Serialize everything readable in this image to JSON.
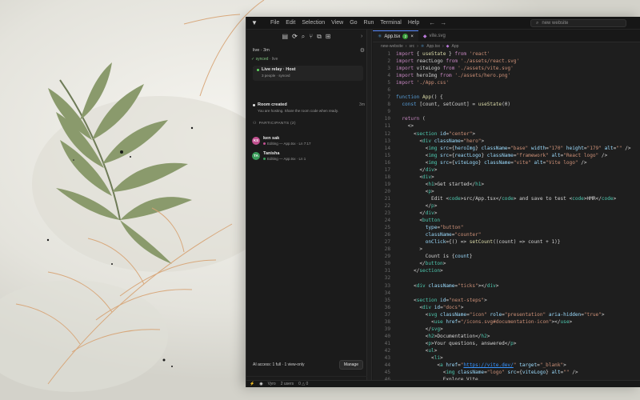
{
  "colors": {
    "accent": "#5b8cff",
    "synced_green": "#5fd35f",
    "avatar_ks": "#c0508f",
    "avatar_ta": "#3a9c5a",
    "leaf_green": "#8a9a6c",
    "orange_line": "#d7a272"
  },
  "titlebar": {
    "menu": [
      "File",
      "Edit",
      "Selection",
      "View",
      "Go",
      "Run",
      "Terminal",
      "Help"
    ],
    "search_placeholder": "new website"
  },
  "sidebar": {
    "toolbar_icons": [
      "files-icon",
      "collab-icon",
      "search-icon",
      "branch-icon",
      "extensions-icon",
      "layout-icon"
    ],
    "session": {
      "mode": "live · 3m",
      "code": "VYR-6UEM-E89Z"
    },
    "synced": {
      "label": "✓ synced",
      "rest": " · live"
    },
    "relay": {
      "title": "Live relay · Host",
      "subtitle": "3 people · synced"
    },
    "room": {
      "title": "Room created",
      "time": "3m",
      "subtitle": "You are hosting. Share the room code when ready."
    },
    "participants_header": "PARTICIPANTS (2)",
    "participants": [
      {
        "initials": "KS",
        "name": "ken sak",
        "status": "Editing — App.tsx · Ln 7:17"
      },
      {
        "initials": "TA",
        "name": "Tanisha",
        "status": "Editing — App.tsx · Ln 1"
      }
    ],
    "access": {
      "label": "AI access: 1 full · 1 view-only",
      "manage": "Manage"
    }
  },
  "editor": {
    "tabs": [
      {
        "label": "App.tsx",
        "badge": "2",
        "active": true
      },
      {
        "label": "vite.svg",
        "active": false
      }
    ],
    "breadcrumbs": [
      "new-website",
      "src",
      "App.tsx",
      "App"
    ],
    "lines": [
      "import { useState } from 'react'",
      "import reactLogo from './assets/react.svg'",
      "import viteLogo from './assets/vite.svg'",
      "import heroImg from './assets/hero.png'",
      "import './App.css'",
      "",
      "function App() {",
      "  const [count, setCount] = useState(0)",
      "",
      "  return (",
      "    <>",
      "      <section id=\"center\">",
      "        <div className=\"hero\">",
      "          <img src={heroImg} className=\"base\" width=\"170\" height=\"179\" alt=\"\" />",
      "          <img src={reactLogo} className=\"framework\" alt=\"React logo\" />",
      "          <img src={viteLogo} className=\"vite\" alt=\"Vite logo\" />",
      "        </div>",
      "        <div>",
      "          <h1>Get started</h1>",
      "          <p>",
      "            Edit <code>src/App.tsx</code> and save to test <code>HMR</code>",
      "          </p>",
      "        </div>",
      "        <button",
      "          type=\"button\"",
      "          className=\"counter\"",
      "          onClick={() => setCount((count) => count + 1)}",
      "        >",
      "          Count is {count}",
      "        </button>",
      "      </section>",
      "",
      "      <div className=\"ticks\"></div>",
      "",
      "      <section id=\"next-steps\">",
      "        <div id=\"docs\">",
      "          <svg className=\"icon\" role=\"presentation\" aria-hidden=\"true\">",
      "            <use href=\"/icons.svg#documentation-icon\"></use>",
      "          </svg>",
      "          <h2>Documentation</h2>",
      "          <p>Your questions, answered</p>",
      "          <ul>",
      "            <li>",
      "              <a href=\"https://vite.dev/\" target=\"_blank\">",
      "                <img className=\"logo\" src={viteLogo} alt=\"\" />",
      "                Explore Vite",
      "              </a>"
    ]
  },
  "statusbar": {
    "items": [
      "Vyro",
      "2 users",
      "0 △ 0"
    ]
  }
}
